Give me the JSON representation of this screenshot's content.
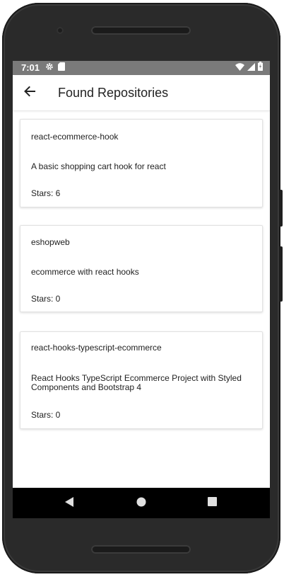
{
  "status_bar": {
    "time": "7:01",
    "left_icons": [
      "gear-icon",
      "sd-card-icon"
    ],
    "right_icons": [
      "wifi-icon",
      "signal-icon",
      "battery-icon"
    ]
  },
  "app_bar": {
    "back_icon": "arrow-left-icon",
    "title": "Found Repositories"
  },
  "repositories": [
    {
      "name": "react-ecommerce-hook",
      "description": "A basic shopping cart hook for react",
      "stars": "Stars: 6"
    },
    {
      "name": "eshopweb",
      "description": "ecommerce with react hooks",
      "stars": "Stars: 0"
    },
    {
      "name": "react-hooks-typescript-ecommerce",
      "description": "React Hooks TypeScript Ecommerce Project with Styled Components and Bootstrap 4",
      "stars": "Stars: 0"
    }
  ],
  "nav_bar": {
    "buttons": [
      "back-triangle-icon",
      "home-circle-icon",
      "recents-square-icon"
    ]
  },
  "colors": {
    "status_bar": "#7a7a7a",
    "device_body": "#2a2a2a",
    "nav_bar": "#000000",
    "text": "#222222"
  }
}
